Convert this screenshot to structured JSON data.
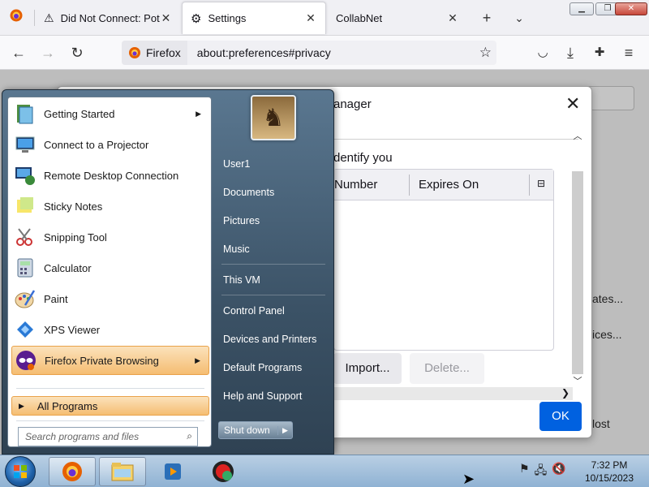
{
  "browser": {
    "tabs": [
      {
        "title": "Did Not Connect: Pote",
        "active": false
      },
      {
        "title": "Settings",
        "active": true
      },
      {
        "title": "CollabNet",
        "active": false
      }
    ],
    "identity_label": "Firefox",
    "url": "about:preferences#privacy"
  },
  "page": {
    "bg_button_1": "ates...",
    "bg_button_2": "ices...",
    "bg_text_3": "lost"
  },
  "dialog": {
    "title": "anager",
    "intro": "dentify you",
    "columns": [
      "Number",
      "Expires On"
    ],
    "import_label": "Import...",
    "delete_label": "Delete...",
    "ok_label": "OK"
  },
  "start_menu": {
    "programs": [
      {
        "label": "Getting Started",
        "icon": "getting-started-icon",
        "submenu": true
      },
      {
        "label": "Connect to a Projector",
        "icon": "projector-icon",
        "submenu": false
      },
      {
        "label": "Remote Desktop Connection",
        "icon": "remote-desktop-icon",
        "submenu": false
      },
      {
        "label": "Sticky Notes",
        "icon": "sticky-notes-icon",
        "submenu": false
      },
      {
        "label": "Snipping Tool",
        "icon": "snipping-tool-icon",
        "submenu": false
      },
      {
        "label": "Calculator",
        "icon": "calculator-icon",
        "submenu": false
      },
      {
        "label": "Paint",
        "icon": "paint-icon",
        "submenu": false
      },
      {
        "label": "XPS Viewer",
        "icon": "xps-viewer-icon",
        "submenu": false
      },
      {
        "label": "Firefox Private Browsing",
        "icon": "private-browsing-icon",
        "submenu": true
      }
    ],
    "all_programs": "All Programs",
    "search_placeholder": "Search programs and files",
    "places": [
      "User1",
      "Documents",
      "Pictures",
      "Music",
      "This VM",
      "Control Panel",
      "Devices and Printers",
      "Default Programs",
      "Help and Support"
    ],
    "shutdown_label": "Shut down"
  },
  "taskbar": {
    "time": "7:32 PM",
    "date": "10/15/2023"
  },
  "colors": {
    "accent": "#0061e0",
    "start_highlight": "#f5bd72"
  }
}
